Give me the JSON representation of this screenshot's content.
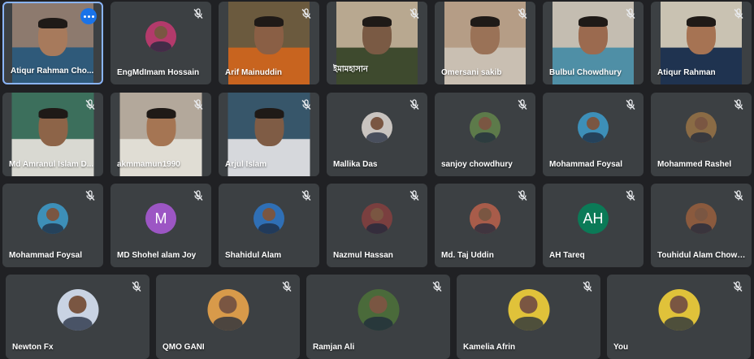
{
  "participants_row1": [
    {
      "name": "Atiqur Rahman Cho...",
      "mode": "video",
      "bg": "#8d7a6e",
      "fg": "#2f5a7a",
      "face": "#a77a5c"
    },
    {
      "name": "EngMdImam Hossain",
      "mode": "avatar",
      "avatar_bg": "#b33a6b"
    },
    {
      "name": "Arif Mainuddin",
      "mode": "video",
      "bg": "#6b5a3e",
      "fg": "#c8641f",
      "face": "#8a5f45"
    },
    {
      "name": "ইমামহাসান",
      "mode": "video",
      "bg": "#b8a890",
      "fg": "#3e4a2e",
      "face": "#7a5a44"
    },
    {
      "name": "Omersani sakib",
      "mode": "video",
      "bg": "#b59d86",
      "fg": "#c9bfb2",
      "face": "#9a7257"
    },
    {
      "name": "Bulbul Chowdhury",
      "mode": "video",
      "bg": "#c4bdb1",
      "fg": "#4f8fa6",
      "face": "#9b6a4f"
    },
    {
      "name": "Atiqur Rahman",
      "mode": "video",
      "bg": "#c9c2b2",
      "fg": "#1f3350",
      "face": "#a67353"
    }
  ],
  "participants_row2": [
    {
      "name": "Md Amranul Islam D...",
      "mode": "video",
      "bg": "#3c6f5c",
      "fg": "#d9d9d2",
      "face": "#8d6448"
    },
    {
      "name": "akmmamun1990",
      "mode": "video",
      "bg": "#b3a89b",
      "fg": "#e0ddd4",
      "face": "#a57553"
    },
    {
      "name": "Arjul Islam",
      "mode": "video",
      "bg": "#37566a",
      "fg": "#d6d8dc",
      "face": "#7f5c45"
    },
    {
      "name": "Mallika Das",
      "mode": "avatar",
      "avatar_bg": "#c9c4c0"
    },
    {
      "name": "sanjoy chowdhury",
      "mode": "avatar",
      "avatar_bg": "#5d7a4a"
    },
    {
      "name": "Mohammad Foysal",
      "mode": "avatar",
      "avatar_bg": "#3d8fb8"
    },
    {
      "name": "Mohammed Rashel",
      "mode": "avatar",
      "avatar_bg": "#8a6b45"
    }
  ],
  "participants_row3": [
    {
      "name": "Mohammad Foysal",
      "mode": "avatar",
      "avatar_bg": "#3d8fb8"
    },
    {
      "name": "MD Shohel alam Joy",
      "mode": "letter",
      "letter": "M",
      "avatar_bg": "#9c56c4"
    },
    {
      "name": "Shahidul Alam",
      "mode": "avatar",
      "avatar_bg": "#2f6fb5"
    },
    {
      "name": "Nazmul Hassan",
      "mode": "avatar",
      "avatar_bg": "#7a3f3f"
    },
    {
      "name": "Md. Taj Uddin",
      "mode": "avatar",
      "avatar_bg": "#a85c4a"
    },
    {
      "name": "AH Tareq",
      "mode": "letter",
      "letter": "AH",
      "avatar_bg": "#0b7a57"
    },
    {
      "name": "Touhidul Alam Chowd...",
      "mode": "avatar",
      "avatar_bg": "#8a5a3e"
    }
  ],
  "participants_row4": [
    {
      "name": "Newton Fx",
      "mode": "avatar",
      "avatar_bg": "#c9d3e3"
    },
    {
      "name": "QMO GANI",
      "mode": "avatar",
      "avatar_bg": "#d89a4a"
    },
    {
      "name": "Ramjan Ali",
      "mode": "avatar",
      "avatar_bg": "#4a6a3a"
    },
    {
      "name": "Kamelia Afrin",
      "mode": "avatar",
      "avatar_bg": "#e0c23a"
    },
    {
      "name": "You",
      "mode": "avatar",
      "avatar_bg": "#e0c23a"
    }
  ]
}
